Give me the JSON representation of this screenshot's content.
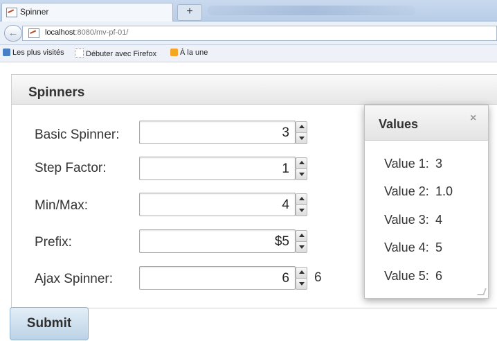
{
  "browser": {
    "tab_title": "Spinner",
    "new_tab_label": "+",
    "url_host": "localhost",
    "url_rest": ":8080/mv-pf-01/",
    "bookmarks": [
      "Les plus visités",
      "Débuter avec Firefox",
      "À la une"
    ]
  },
  "page": {
    "panel_title": "Spinners",
    "fields": [
      {
        "label": "Basic Spinner:",
        "value": "3"
      },
      {
        "label": "Step Factor:",
        "value": "1"
      },
      {
        "label": "Min/Max:",
        "value": "4"
      },
      {
        "label": "Prefix:",
        "value": "$5"
      },
      {
        "label": "Ajax Spinner:",
        "value": "6",
        "output": "6"
      }
    ],
    "submit_label": "Submit"
  },
  "dialog": {
    "title": "Values",
    "close_symbol": "×",
    "rows": [
      {
        "label": "Value 1:",
        "value": "3"
      },
      {
        "label": "Value 2:",
        "value": "1.0"
      },
      {
        "label": "Value 3:",
        "value": "4"
      },
      {
        "label": "Value 4:",
        "value": "5"
      },
      {
        "label": "Value 5:",
        "value": "6"
      }
    ]
  }
}
